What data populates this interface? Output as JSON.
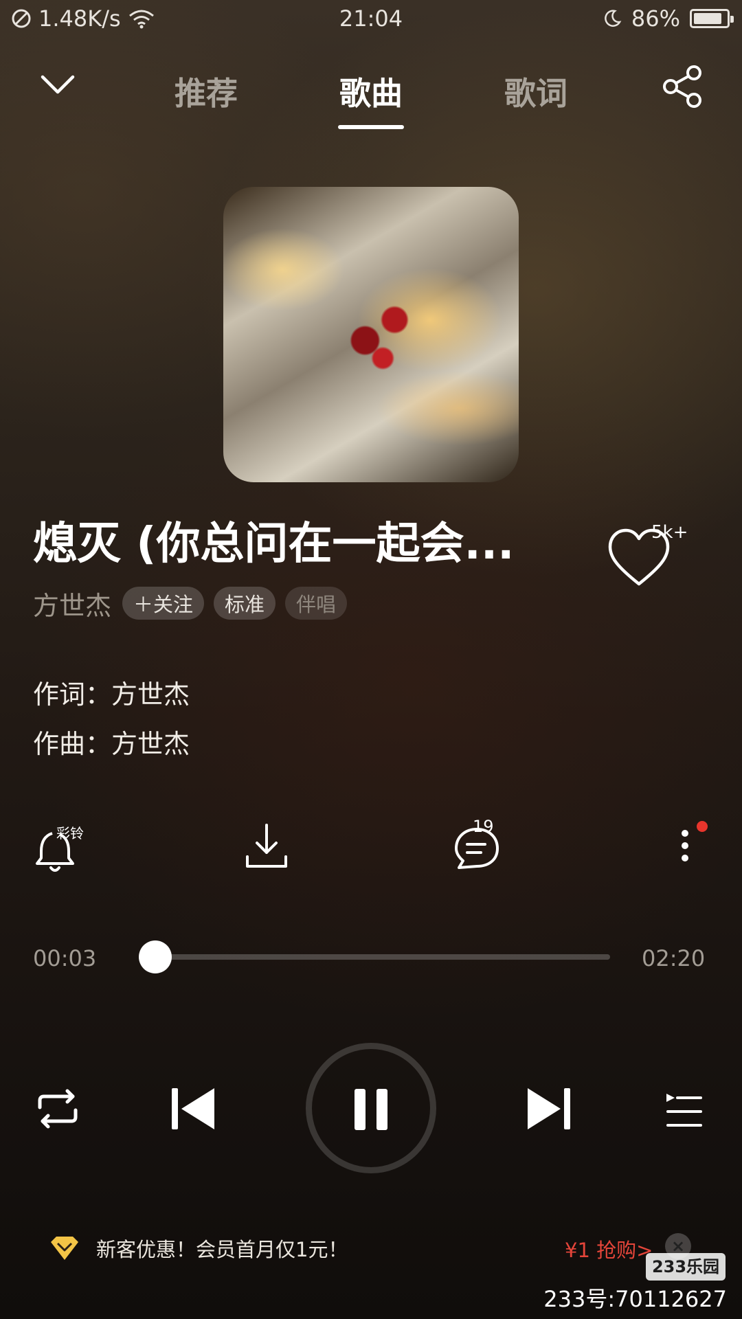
{
  "status_bar": {
    "network_speed": "1.48K/s",
    "time": "21:04",
    "battery": "86%",
    "battery_level": 0.86,
    "icons": [
      "no-sim-icon",
      "wifi-icon",
      "moon-icon",
      "battery-icon"
    ]
  },
  "nav": {
    "tabs": [
      {
        "label": "推荐",
        "active": false
      },
      {
        "label": "歌曲",
        "active": true
      },
      {
        "label": "歌词",
        "active": false
      }
    ]
  },
  "song": {
    "title": "熄灭 (你总问在一起会...",
    "like_count": "5k+",
    "artist": "方世杰",
    "follow_label": "＋关注",
    "quality_label": "标准",
    "accompaniment_label": "伴唱",
    "lyricist": "作词：方世杰",
    "composer": "作曲：方世杰"
  },
  "actions": {
    "ringtone_label": "彩铃",
    "comment_count": "19"
  },
  "player": {
    "current_time": "00:03",
    "total_time": "02:20",
    "progress": 0.02
  },
  "promo": {
    "text": "新客优惠！会员首月仅1元！",
    "cta": "¥1 抢购>",
    "close": "×"
  },
  "watermark": {
    "logo": "233乐园",
    "id": "233号:70112627"
  },
  "colors": {
    "accent_red": "#e5453a",
    "vip_gold": "#f3c446"
  }
}
